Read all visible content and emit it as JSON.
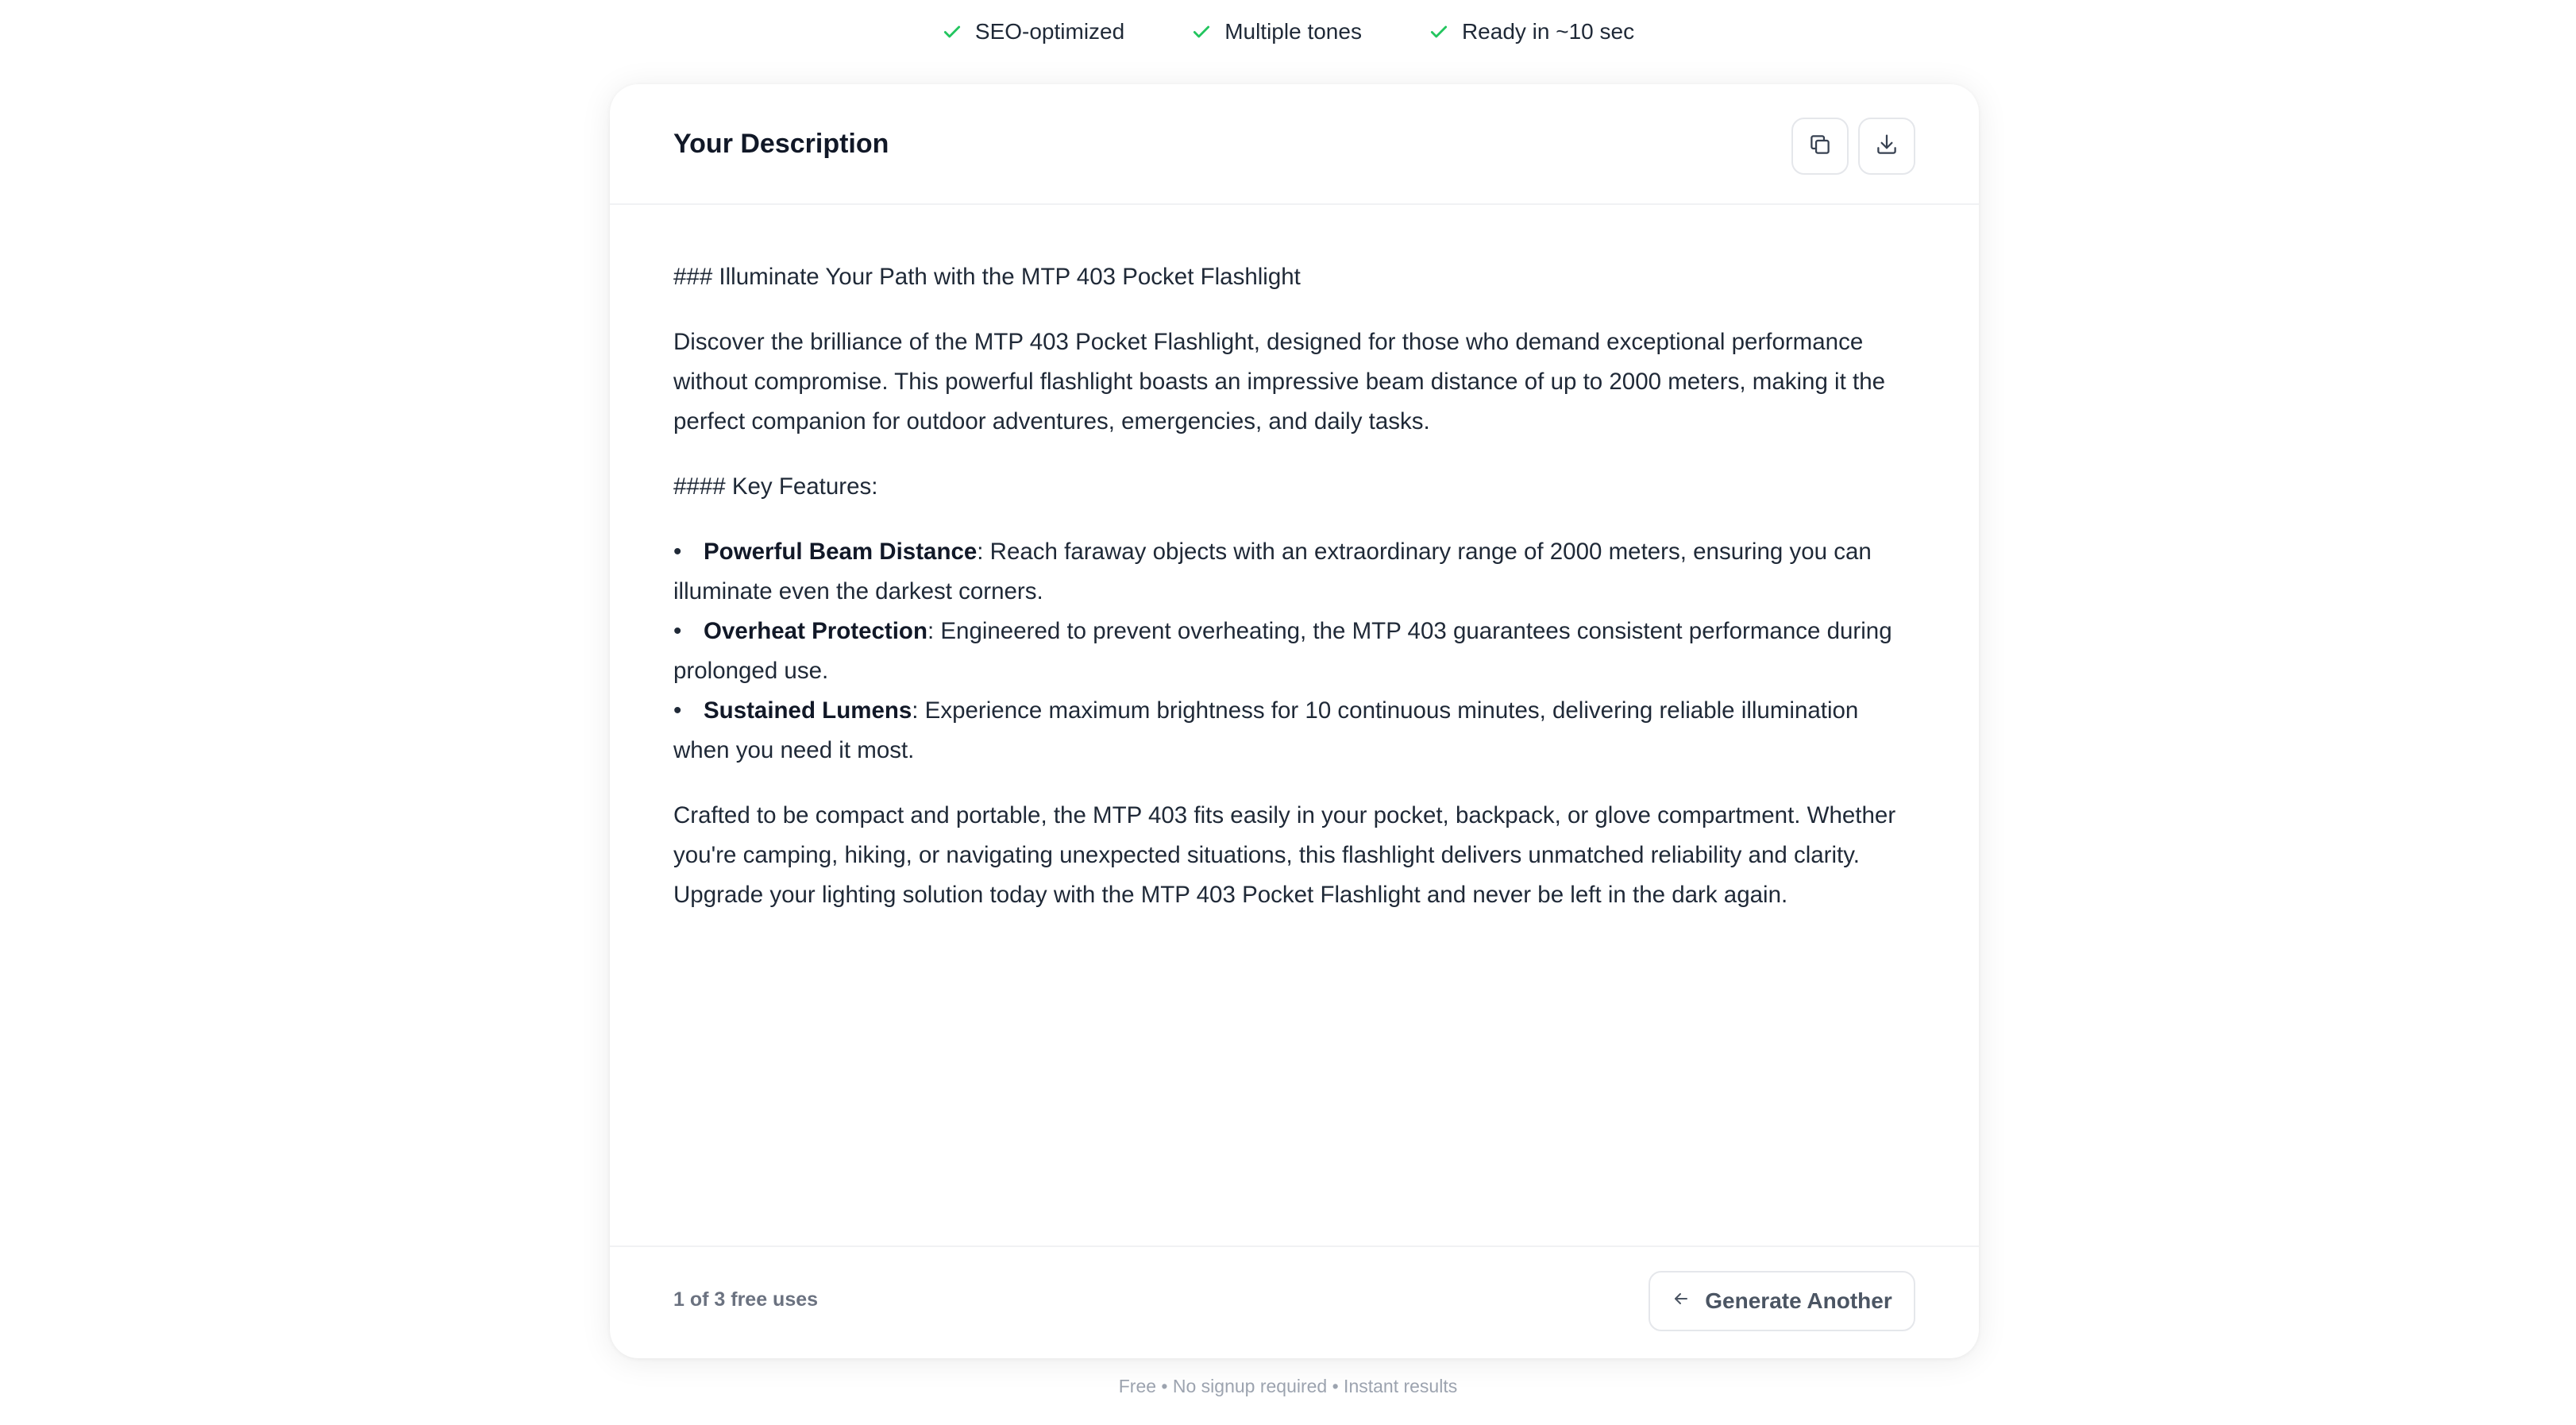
{
  "features": [
    {
      "icon": "check-icon",
      "label": "SEO-optimized"
    },
    {
      "icon": "check-icon",
      "label": "Multiple tones"
    },
    {
      "icon": "check-icon",
      "label": "Ready in ~10 sec"
    }
  ],
  "colors": {
    "check": "#22c55e",
    "text": "#1f2937",
    "muted": "#6b7280",
    "border": "#e5e7eb"
  },
  "card": {
    "title": "Your Description",
    "copy_icon": "copy-icon",
    "download_icon": "download-icon",
    "content": {
      "heading": "### Illuminate Your Path with the MTP 403 Pocket Flashlight",
      "intro": "Discover the brilliance of the MTP 403 Pocket Flashlight, designed for those who demand exceptional performance without compromise. This powerful flashlight boasts an impressive beam distance of up to 2000 meters, making it the perfect companion for outdoor adventures, emergencies, and daily tasks.",
      "subheading": "#### Key Features:",
      "features": [
        {
          "title": "Powerful Beam Distance",
          "text": ": Reach faraway objects with an extraordinary range of 2000 meters, ensuring you can illuminate even the darkest corners."
        },
        {
          "title": "Overheat Protection",
          "text": ": Engineered to prevent overheating, the MTP 403 guarantees consistent performance during prolonged use."
        },
        {
          "title": "Sustained Lumens",
          "text": ": Experience maximum brightness for 10 continuous minutes, delivering reliable illumination when you need it most."
        }
      ],
      "closing": "Crafted to be compact and portable, the MTP 403 fits easily in your pocket, backpack, or glove compartment. Whether you're camping, hiking, or navigating unexpected situations, this flashlight delivers unmatched reliability and clarity. Upgrade your lighting solution today with the MTP 403 Pocket Flashlight and never be left in the dark again."
    },
    "footer": {
      "usage": "1 of 3 free uses",
      "generate_label": "Generate Another",
      "generate_icon": "arrow-left-icon"
    }
  },
  "footnote": "Free • No signup required • Instant results"
}
